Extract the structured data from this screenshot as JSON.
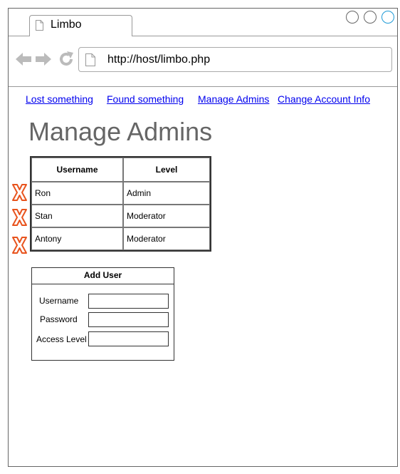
{
  "browser": {
    "tab_title": "Limbo",
    "url": "http://host/limbo.php"
  },
  "nav": {
    "links": [
      {
        "label": "Lost something"
      },
      {
        "label": "Found something"
      },
      {
        "label": "Manage Admins"
      },
      {
        "label": "Change Account Info"
      }
    ]
  },
  "page": {
    "title": "Manage Admins"
  },
  "admins_table": {
    "columns": [
      "Username",
      "Level"
    ],
    "rows": [
      {
        "username": "Ron",
        "level": "Admin"
      },
      {
        "username": "Stan",
        "level": "Moderator"
      },
      {
        "username": "Antony",
        "level": "Moderator"
      }
    ]
  },
  "add_user": {
    "title": "Add User",
    "username_label": "Username",
    "password_label": "Password",
    "access_level_label": "Access Level",
    "username_value": "",
    "password_value": "",
    "access_level_value": ""
  },
  "icons": {
    "delete": "delete-x-icon",
    "back": "arrow-left-icon",
    "forward": "arrow-right-icon",
    "reload": "reload-icon",
    "page": "page-icon"
  },
  "colors": {
    "delete_icon": "#e8541e",
    "link": "#0000ee",
    "title": "#666666",
    "window_button_active": "#1e9ad6"
  }
}
